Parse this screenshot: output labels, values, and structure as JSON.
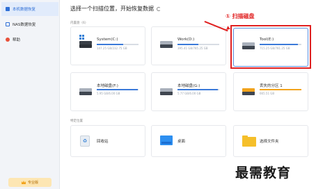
{
  "sidebar": {
    "items": [
      {
        "label": "本机数据恢复",
        "active": true,
        "icon": "computer-icon"
      },
      {
        "label": "NAS数据恢复",
        "active": false,
        "icon": "nas-icon"
      },
      {
        "label": "帮助",
        "active": false,
        "icon": "help-icon"
      }
    ],
    "upgrade_label": "专业版"
  },
  "header": {
    "title": "选择一个扫描位置，开始恢复数据"
  },
  "sections": {
    "hard_disks": "内置盘（6）",
    "specific_locations": "特定位置"
  },
  "drives": [
    {
      "name": "System(C:)",
      "size": "147.25 GB/232.75 GB",
      "used": 0.63,
      "color": "#3b7ad9",
      "icon": "windows-drive-icon"
    },
    {
      "name": "Work(D:)",
      "size": "395.41 GB/785.25 GB",
      "used": 0.5,
      "color": "#3b7ad9",
      "icon": "drive-icon"
    },
    {
      "name": "Tool(E:)",
      "size": "715.25 GB/781.25 GB",
      "used": 0.92,
      "color": "#3b7ad9",
      "icon": "drive-icon"
    },
    {
      "name": "本地磁盘(F:)",
      "size": "5.95 GB/6.00 GB",
      "used": 0.99,
      "color": "#3b7ad9",
      "icon": "drive-icon"
    },
    {
      "name": "本地磁盘(G:)",
      "size": "5.77 GB/6.00 GB",
      "used": 0.96,
      "color": "#3b7ad9",
      "icon": "drive-icon"
    },
    {
      "name": "丢失的分区 1",
      "size": "665.51 GB",
      "used": 1.0,
      "color": "#f2a31c",
      "icon": "lost-drive-icon"
    }
  ],
  "locations": [
    {
      "name": "回收站",
      "icon": "recycle-bin-icon"
    },
    {
      "name": "桌面",
      "icon": "desktop-icon"
    },
    {
      "name": "选择文件夹",
      "icon": "folder-icon"
    }
  ],
  "annotation": "① 扫描磁盘",
  "watermark": "最需教育"
}
